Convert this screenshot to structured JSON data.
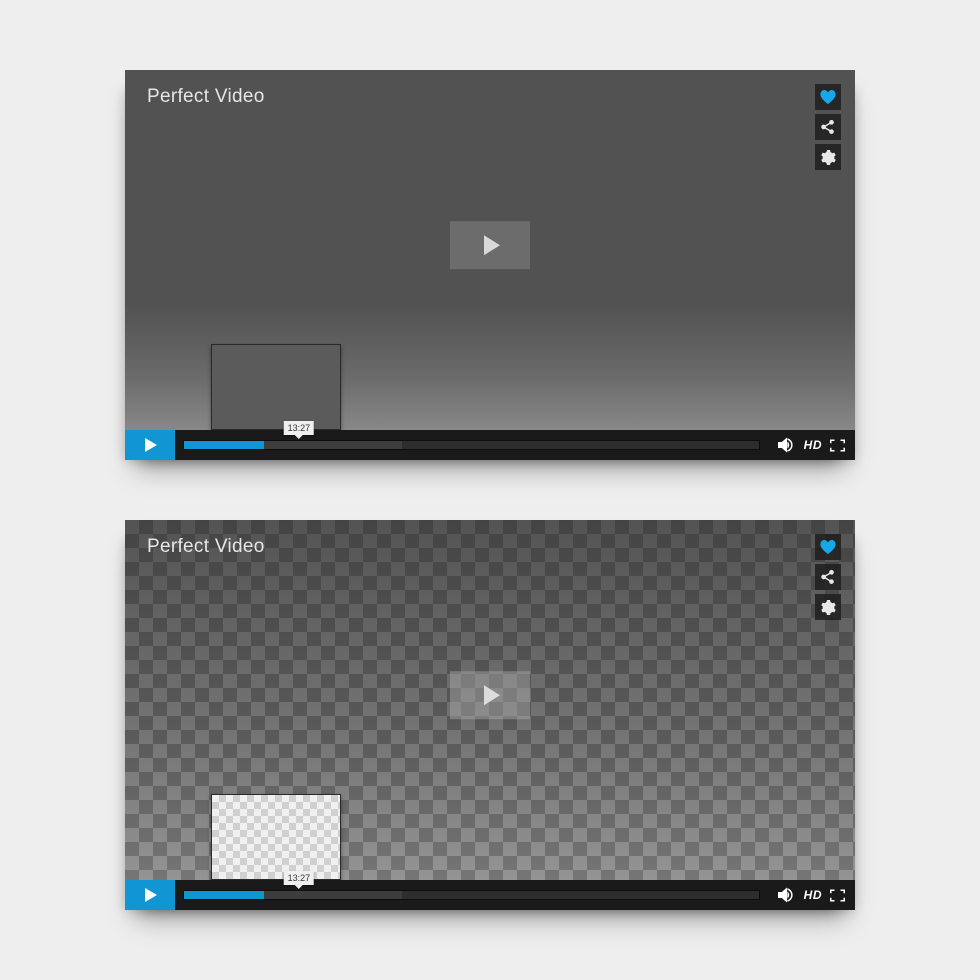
{
  "players": [
    {
      "title": "Perfect Video",
      "timestamp": "13:27",
      "hd_label": "HD",
      "played_percent": 14,
      "buffered_percent": 38,
      "tip_left_percent": 20
    },
    {
      "title": "Perfect Video",
      "timestamp": "13:27",
      "hd_label": "HD",
      "played_percent": 14,
      "buffered_percent": 38,
      "tip_left_percent": 20
    }
  ],
  "colors": {
    "accent": "#1295d3",
    "heart": "#18a7e6"
  }
}
